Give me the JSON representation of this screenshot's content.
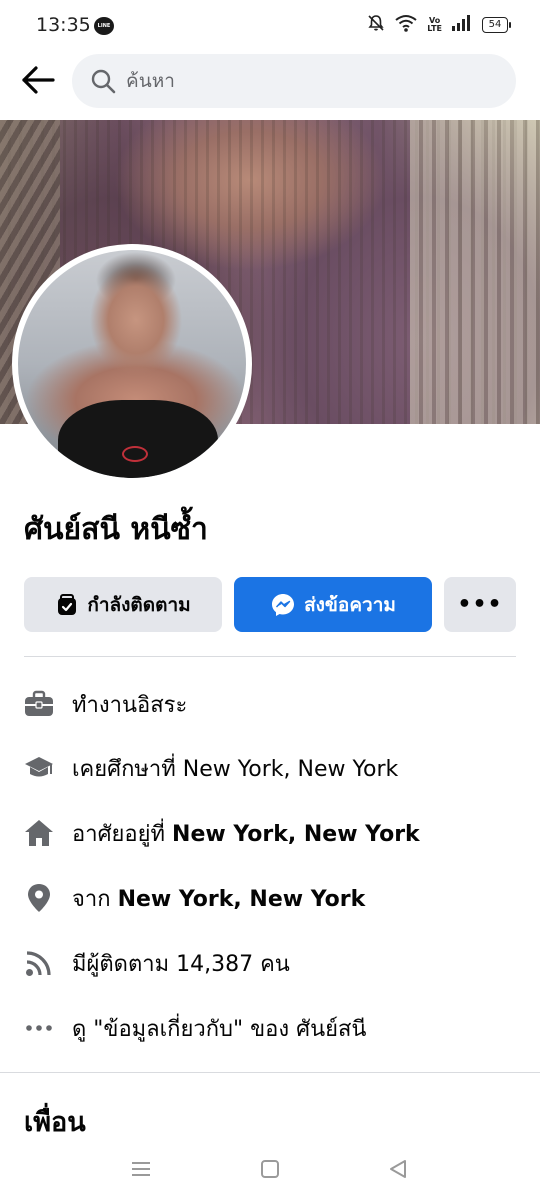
{
  "status_bar": {
    "time": "13:35",
    "line_app_icon": "line-icon",
    "icons": [
      "mute-icon",
      "wifi-icon",
      "volte-icon",
      "signal-icon"
    ],
    "volte_top": "Vo",
    "volte_bottom": "LTE",
    "battery": "54"
  },
  "top_nav": {
    "back_icon": "back-arrow-icon",
    "search_placeholder": "ค้นหา"
  },
  "profile": {
    "name": "ศันย์สนี หนีซ้ำ"
  },
  "actions": {
    "follow_label": "กำลังติดตาม",
    "message_label": "ส่งข้อความ",
    "more_label": "•••"
  },
  "info": [
    {
      "icon": "briefcase-icon",
      "text": "ทำงานอิสระ",
      "bold": ""
    },
    {
      "icon": "graduation-cap-icon",
      "text": "เคยศึกษาที่ New York, New York",
      "bold": ""
    },
    {
      "icon": "home-icon",
      "text": "อาศัยอยู่ที่ ",
      "bold": "New York, New York"
    },
    {
      "icon": "location-pin-icon",
      "text": "จาก ",
      "bold": "New York, New York"
    },
    {
      "icon": "rss-feed-icon",
      "text": "มีผู้ติดตาม 14,387 คน",
      "bold": ""
    },
    {
      "icon": "more-dots-icon",
      "text": "ดู \"ข้อมูลเกี่ยวกับ\" ของ ศันย์สนี",
      "bold": ""
    }
  ],
  "friends_section": {
    "title": "เพื่อน"
  },
  "colors": {
    "primary": "#1b74e4",
    "secondary_button": "#e4e6eb",
    "search_bg": "#f0f2f5",
    "icon_gray": "#65676b"
  }
}
